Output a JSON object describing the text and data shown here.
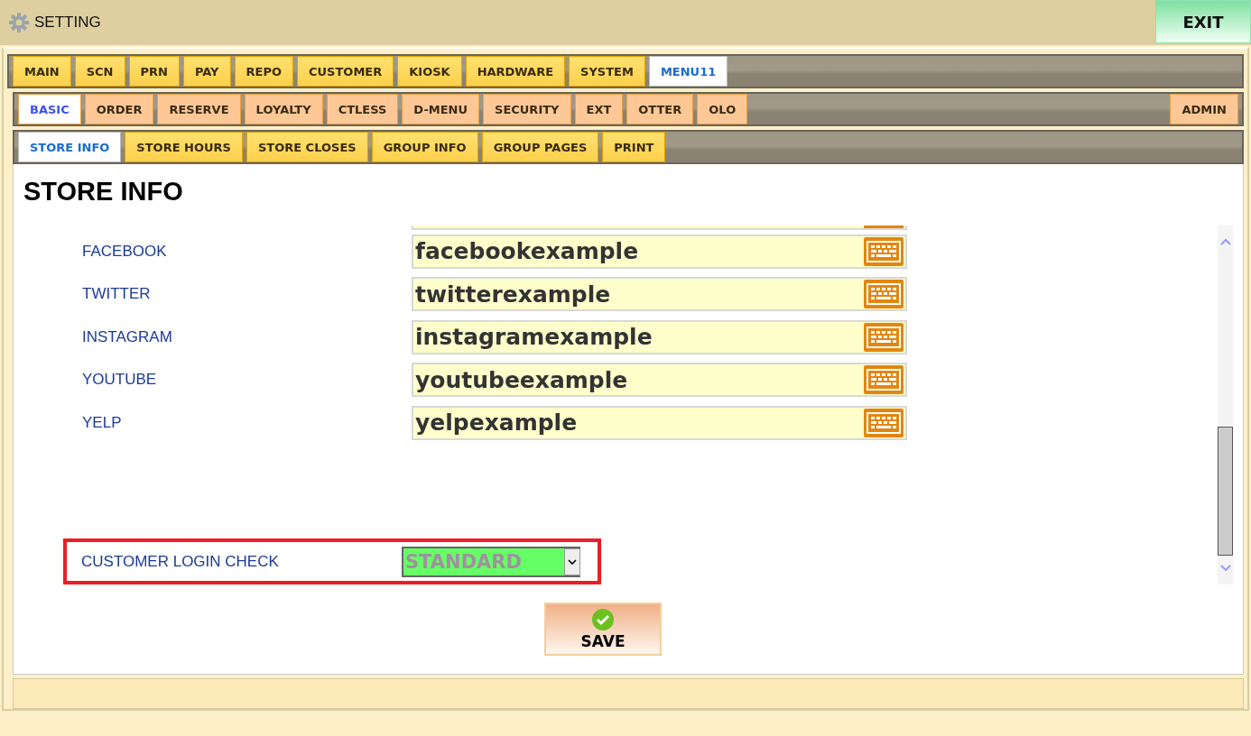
{
  "window": {
    "title": "SETTING",
    "exit_button": "EXIT"
  },
  "main_tabs": [
    {
      "label": "MAIN",
      "selected": false
    },
    {
      "label": "SCN",
      "selected": false
    },
    {
      "label": "PRN",
      "selected": false
    },
    {
      "label": "PAY",
      "selected": false
    },
    {
      "label": "REPO",
      "selected": false
    },
    {
      "label": "CUSTOMER",
      "selected": false
    },
    {
      "label": "KIOSK",
      "selected": false
    },
    {
      "label": "HARDWARE",
      "selected": false
    },
    {
      "label": "SYSTEM",
      "selected": false
    },
    {
      "label": "MENU11",
      "selected": true
    }
  ],
  "sub_tabs": [
    {
      "label": "BASIC",
      "selected": true
    },
    {
      "label": "ORDER",
      "selected": false
    },
    {
      "label": "RESERVE",
      "selected": false
    },
    {
      "label": "LOYALTY",
      "selected": false
    },
    {
      "label": "CTLESS",
      "selected": false
    },
    {
      "label": "D-MENU",
      "selected": false
    },
    {
      "label": "SECURITY",
      "selected": false
    },
    {
      "label": "EXT",
      "selected": false
    },
    {
      "label": "OTTER",
      "selected": false
    },
    {
      "label": "OLO",
      "selected": false
    }
  ],
  "sub_tabs_end": [
    {
      "label": "ADMIN",
      "selected": false
    }
  ],
  "section_tabs": [
    {
      "label": "STORE INFO",
      "selected": true
    },
    {
      "label": "STORE HOURS",
      "selected": false
    },
    {
      "label": "STORE CLOSES",
      "selected": false
    },
    {
      "label": "GROUP INFO",
      "selected": false
    },
    {
      "label": "GROUP PAGES",
      "selected": false
    },
    {
      "label": "PRINT",
      "selected": false
    }
  ],
  "page_title": "STORE INFO",
  "fields": [
    {
      "label": "FACEBOOK",
      "value": "facebookexample"
    },
    {
      "label": "TWITTER",
      "value": "twitterexample"
    },
    {
      "label": "INSTAGRAM",
      "value": "instagramexample"
    },
    {
      "label": "YOUTUBE",
      "value": "youtubeexample"
    },
    {
      "label": "YELP",
      "value": "yelpexample"
    }
  ],
  "login_check": {
    "label": "CUSTOMER LOGIN CHECK",
    "value": "STANDARD",
    "highlighted": true
  },
  "save_button": "SAVE"
}
